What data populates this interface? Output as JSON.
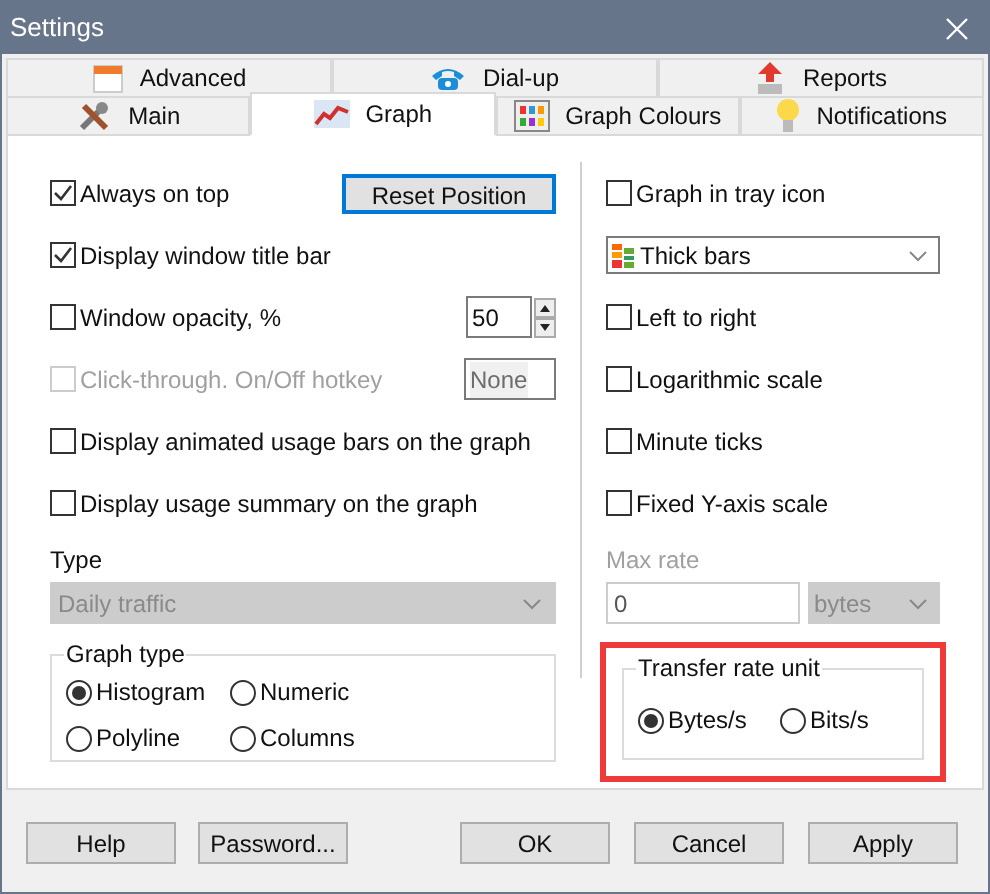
{
  "window": {
    "title": "Settings"
  },
  "tab_rows": [
    [
      {
        "label": "Advanced",
        "selected": false
      },
      {
        "label": "Dial-up",
        "selected": false
      },
      {
        "label": "Reports",
        "selected": false
      }
    ],
    [
      {
        "label": "Main",
        "selected": false
      },
      {
        "label": "Graph",
        "selected": true
      },
      {
        "label": "Graph Colours",
        "selected": false
      },
      {
        "label": "Notifications",
        "selected": false
      }
    ]
  ],
  "left_rows": [
    {
      "label": "Always on top",
      "checked": true,
      "disabled": false,
      "button": {
        "label": "Reset Position",
        "focused": true
      }
    },
    {
      "label": "Display window title bar",
      "checked": true,
      "disabled": false
    },
    {
      "label": "Window opacity, %",
      "checked": false,
      "disabled": false,
      "spin_value": "50"
    },
    {
      "label": "Click-through. On/Off hotkey",
      "checked": false,
      "disabled": true,
      "hotkey": "None"
    },
    {
      "label": "Display animated usage bars on the graph",
      "checked": false,
      "disabled": false
    },
    {
      "label": "Display usage summary on the graph",
      "checked": false,
      "disabled": false
    }
  ],
  "type": {
    "label": "Type",
    "value": "Daily traffic",
    "disabled": true
  },
  "graph_type": {
    "title": "Graph type",
    "options": [
      {
        "label": "Histogram",
        "selected": true
      },
      {
        "label": "Numeric",
        "selected": false
      },
      {
        "label": "Polyline",
        "selected": false
      },
      {
        "label": "Columns",
        "selected": false
      }
    ]
  },
  "right_rows": [
    {
      "kind": "checkbox",
      "label": "Graph in tray icon",
      "checked": false
    },
    {
      "kind": "select",
      "value": "Thick bars"
    },
    {
      "kind": "checkbox",
      "label": "Left to right",
      "checked": false
    },
    {
      "kind": "checkbox",
      "label": "Logarithmic scale",
      "checked": false
    },
    {
      "kind": "checkbox",
      "label": "Minute ticks",
      "checked": false
    },
    {
      "kind": "checkbox",
      "label": "Fixed Y-axis scale",
      "checked": false
    }
  ],
  "max_rate": {
    "label": "Max rate",
    "value": "0",
    "unit": "bytes",
    "disabled": true
  },
  "transfer_rate": {
    "title": "Transfer rate unit",
    "highlighted": true,
    "options": [
      {
        "label": "Bytes/s",
        "selected": true
      },
      {
        "label": "Bits/s",
        "selected": false
      }
    ]
  },
  "buttons": [
    "Help",
    "Password...",
    "OK",
    "Cancel",
    "Apply"
  ]
}
